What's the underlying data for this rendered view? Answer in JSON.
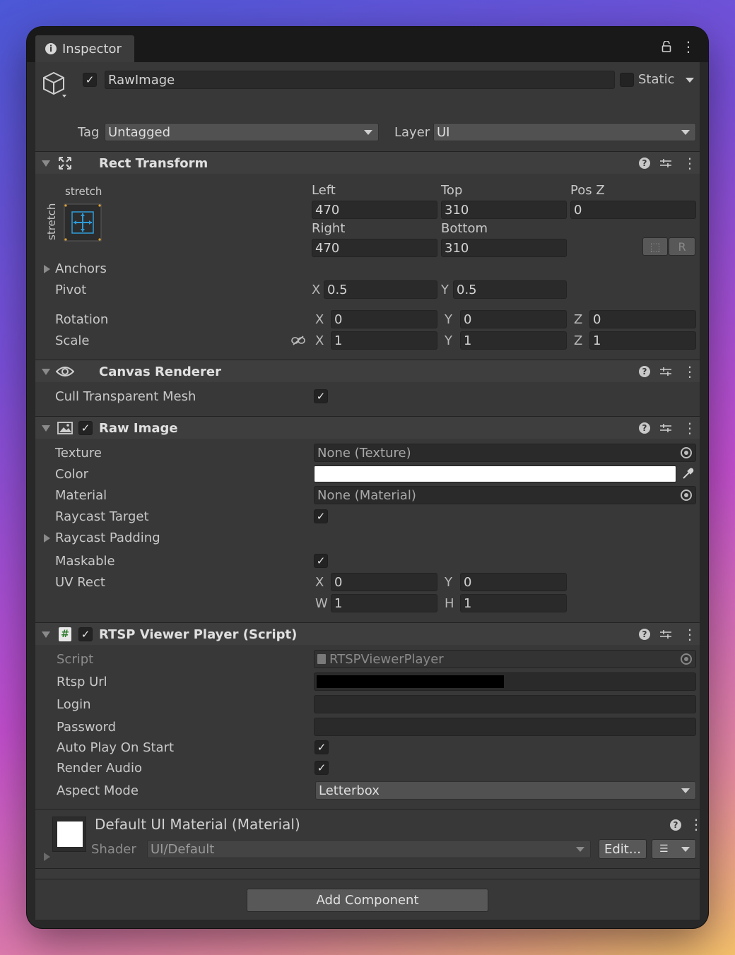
{
  "window": {
    "tab_label": "Inspector"
  },
  "gameobject": {
    "name": "RawImage",
    "active": true,
    "static_label": "Static",
    "tag_label": "Tag",
    "tag_value": "Untagged",
    "layer_label": "Layer",
    "layer_value": "UI"
  },
  "rect_transform": {
    "title": "Rect Transform",
    "anchor_h": "stretch",
    "anchor_v": "stretch",
    "left_label": "Left",
    "left": "470",
    "top_label": "Top",
    "top": "310",
    "posz_label": "Pos Z",
    "posz": "0",
    "right_label": "Right",
    "right": "470",
    "bottom_label": "Bottom",
    "bottom": "310",
    "blueprint_btn": "⬚",
    "raw_btn": "R",
    "anchors_label": "Anchors",
    "pivot_label": "Pivot",
    "pivot_x": "0.5",
    "pivot_y": "0.5",
    "rotation_label": "Rotation",
    "rot_x": "0",
    "rot_y": "0",
    "rot_z": "0",
    "scale_label": "Scale",
    "scale_x": "1",
    "scale_y": "1",
    "scale_z": "1"
  },
  "canvas_renderer": {
    "title": "Canvas Renderer",
    "cull_label": "Cull Transparent Mesh",
    "cull": true
  },
  "raw_image": {
    "title": "Raw Image",
    "enabled": true,
    "texture_label": "Texture",
    "texture_value": "None (Texture)",
    "color_label": "Color",
    "color_value": "#ffffff",
    "material_label": "Material",
    "material_value": "None (Material)",
    "raycast_target_label": "Raycast Target",
    "raycast_padding_label": "Raycast Padding",
    "maskable_label": "Maskable",
    "uvrect_label": "UV Rect",
    "uv_x": "0",
    "uv_y": "0",
    "uv_w": "1",
    "uv_h": "1"
  },
  "rtsp": {
    "title": "RTSP Viewer Player (Script)",
    "enabled": true,
    "script_label": "Script",
    "script_value": "RTSPViewerPlayer",
    "url_label": "Rtsp Url",
    "login_label": "Login",
    "password_label": "Password",
    "autoplay_label": "Auto Play On Start",
    "render_audio_label": "Render Audio",
    "aspect_label": "Aspect Mode",
    "aspect_value": "Letterbox"
  },
  "material": {
    "title": "Default UI Material (Material)",
    "shader_label": "Shader",
    "shader_value": "UI/Default",
    "edit_label": "Edit..."
  },
  "add_component_label": "Add Component",
  "icons": {
    "axis_x": "X",
    "axis_y": "Y",
    "axis_z": "Z",
    "axis_w": "W",
    "axis_h": "H",
    "check": "✓",
    "question": "?",
    "kebab": "⋮",
    "hash": "#",
    "lock": "⌂",
    "link_broken": "⛓",
    "eyedropper": "✎",
    "list": "☰"
  },
  "colors": {
    "panel_bg": "#383838",
    "header_bg": "#3e3e3e",
    "field_bg": "#2a2a2a",
    "anchor_accent": "#2f9bd8",
    "anchor_corner": "#e0a030"
  }
}
